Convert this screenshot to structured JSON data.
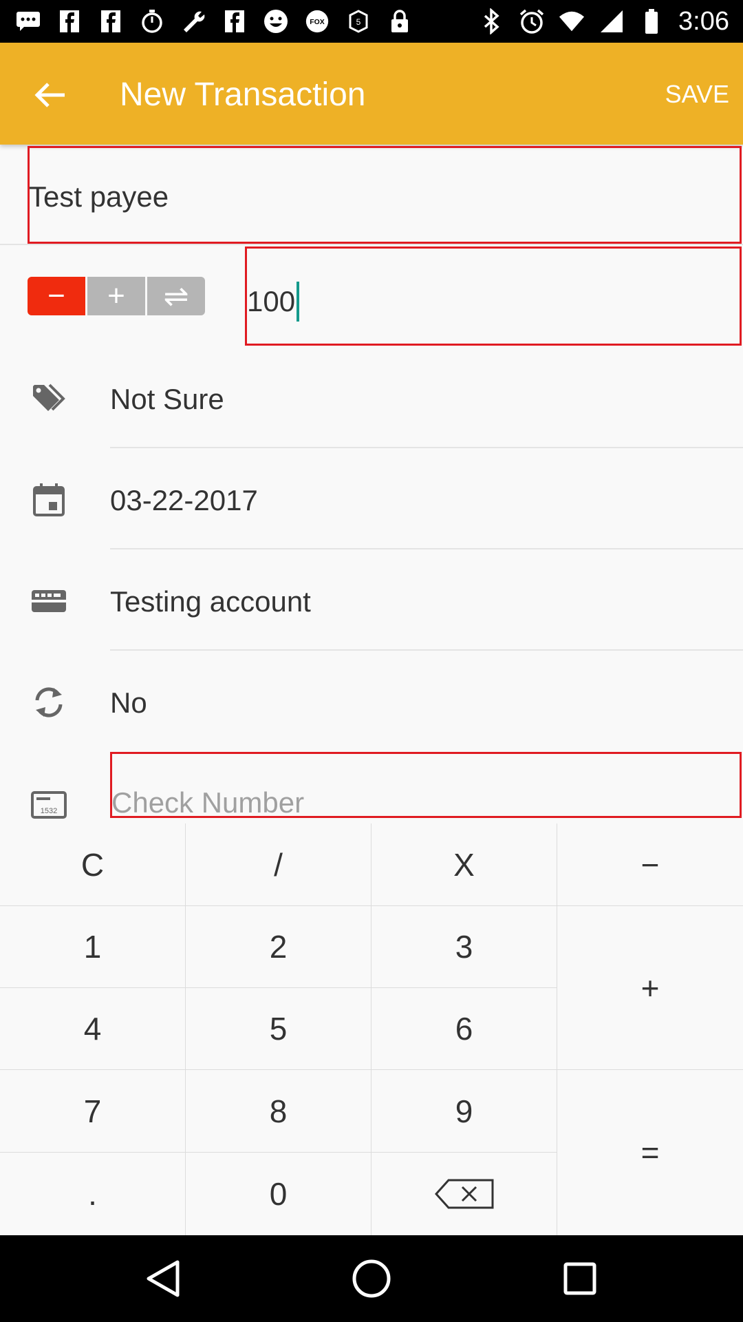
{
  "status_bar": {
    "time": "3:06",
    "icons": [
      "chat-icon",
      "facebook-icon",
      "facebook-icon",
      "stopwatch-icon",
      "wrench-icon",
      "facebook-icon",
      "smiley-icon",
      "fox-sports-icon",
      "app-icon",
      "lock-icon",
      "bluetooth-icon",
      "alarm-icon",
      "wifi-icon",
      "signal-icon",
      "battery-icon"
    ],
    "fox_label": "FOX"
  },
  "app_bar": {
    "title": "New Transaction",
    "save_label": "SAVE",
    "color": "#eeb126"
  },
  "form": {
    "payee": "Test payee",
    "type_buttons": [
      {
        "symbol": "−",
        "name": "expense",
        "active": true
      },
      {
        "symbol": "+",
        "name": "income",
        "active": false
      },
      {
        "symbol": "⇌",
        "name": "transfer",
        "active": false
      }
    ],
    "amount": "100",
    "category": "Not Sure",
    "date": "03-22-2017",
    "account": "Testing account",
    "recurring": "No",
    "check_number_placeholder": "Check Number",
    "check_icon_text": "1532"
  },
  "keypad": {
    "keys": [
      {
        "label": "C",
        "name": "key-clear"
      },
      {
        "label": "/",
        "name": "key-divide"
      },
      {
        "label": "X",
        "name": "key-multiply"
      },
      {
        "label": "−",
        "name": "key-minus"
      },
      {
        "label": "1",
        "name": "key-1"
      },
      {
        "label": "2",
        "name": "key-2"
      },
      {
        "label": "3",
        "name": "key-3"
      },
      {
        "label": "+",
        "name": "key-plus"
      },
      {
        "label": "4",
        "name": "key-4"
      },
      {
        "label": "5",
        "name": "key-5"
      },
      {
        "label": "6",
        "name": "key-6"
      },
      {
        "label": "7",
        "name": "key-7"
      },
      {
        "label": "8",
        "name": "key-8"
      },
      {
        "label": "9",
        "name": "key-9"
      },
      {
        "label": "=",
        "name": "key-equals"
      },
      {
        "label": ".",
        "name": "key-decimal"
      },
      {
        "label": "0",
        "name": "key-0"
      },
      {
        "label": "",
        "name": "key-backspace"
      }
    ]
  },
  "nav_bar": {
    "buttons": [
      "back-nav-icon",
      "home-nav-icon",
      "recents-nav-icon"
    ]
  },
  "colors": {
    "accent": "#eeb126",
    "expense_active": "#f02b0e",
    "inactive_segment": "#b5b5b5",
    "highlight_border": "#e01b22",
    "caret": "#159a8c"
  }
}
